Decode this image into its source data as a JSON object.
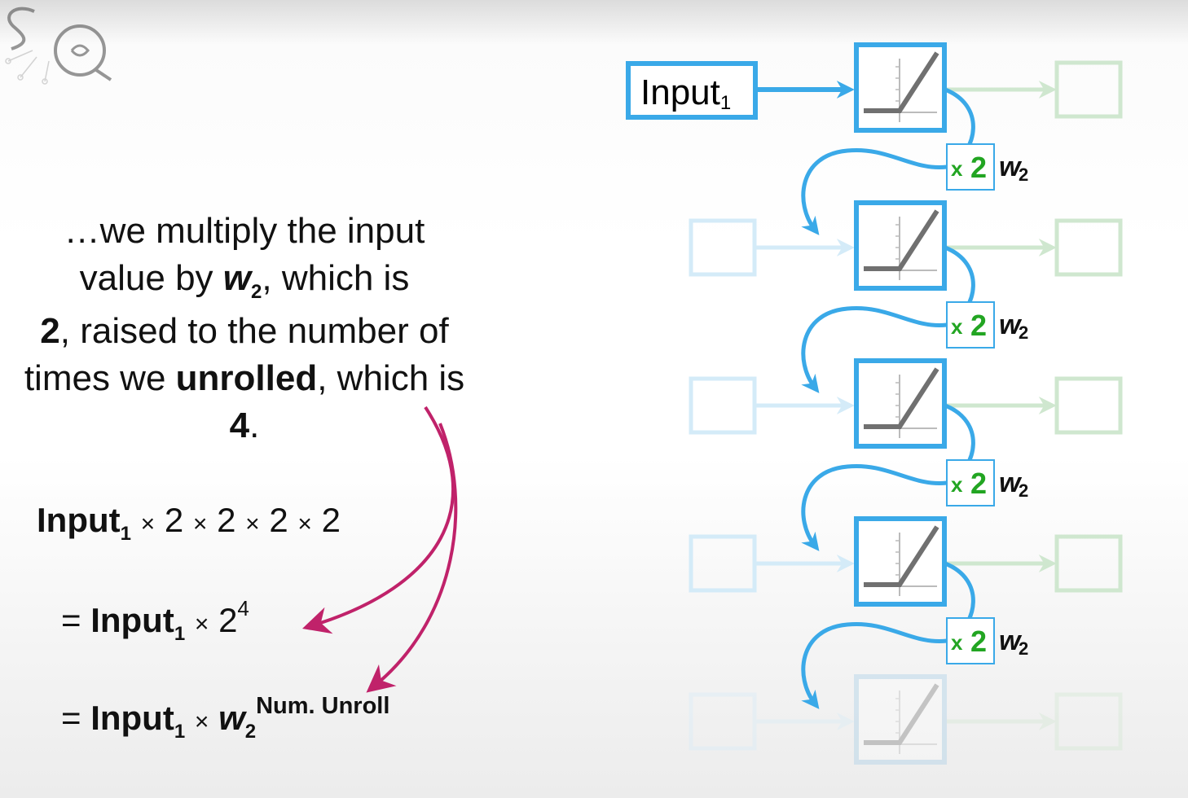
{
  "logo": {
    "text": "SQ",
    "icon": "statquest-logo-icon"
  },
  "explanation": {
    "part1": "…we multiply the input value by ",
    "w": "w",
    "w_sub": "2",
    "part2": ", which is ",
    "value": "2",
    "part3": ", raised to the number of times we ",
    "unrolled": "unrolled",
    "part4": ", which is ",
    "count": "4",
    "part5": "."
  },
  "equations": {
    "eq1": {
      "input": "Input",
      "sub": "1",
      "times": "×",
      "factors": [
        "2",
        "2",
        "2",
        "2"
      ]
    },
    "eq2": {
      "equals": "=",
      "input": "Input",
      "sub": "1",
      "times": "×",
      "base": "2",
      "exponent": "4"
    },
    "eq3": {
      "equals": "=",
      "input": "Input",
      "sub": "1",
      "times": "×",
      "w": "w",
      "w_sub": "2",
      "exponent": "Num. Unroll"
    }
  },
  "diagram": {
    "input_label": "Input",
    "input_sub": "1",
    "multiplier_times": "x",
    "multiplier_value": "2",
    "weight": "w",
    "weight_sub": "2",
    "unroll_count": 4,
    "colors": {
      "blue": "#3aa9e8",
      "green": "#22a522",
      "magenta": "#c0226a",
      "faded_blue": "#d4ebf8",
      "faded_green": "#cfe7cf"
    }
  }
}
